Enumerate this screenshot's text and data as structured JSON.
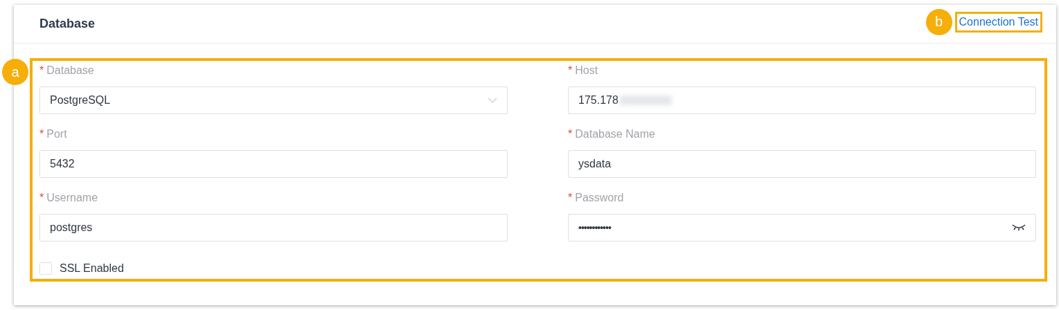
{
  "panel": {
    "title": "Database",
    "link": {
      "label": "Connection Test",
      "badge": "b"
    }
  },
  "form": {
    "badge": "a",
    "fields": [
      {
        "kind": "select",
        "marker": "*",
        "label": "Database",
        "value": "PostgreSQL"
      },
      {
        "kind": "text",
        "marker": "*",
        "label": "Host",
        "value": "175.178",
        "redacted": true
      },
      {
        "kind": "text",
        "marker": "*",
        "label": "Port",
        "value": "5432"
      },
      {
        "kind": "text",
        "marker": "*",
        "label": "Database Name",
        "value": "ysdata"
      },
      {
        "kind": "text",
        "marker": "*",
        "label": "Username",
        "value": "postgres"
      },
      {
        "kind": "password",
        "marker": "*",
        "label": "Password",
        "value": "••••••••••••"
      }
    ],
    "ssl": {
      "label": "SSL Enabled",
      "checked": false
    }
  }
}
